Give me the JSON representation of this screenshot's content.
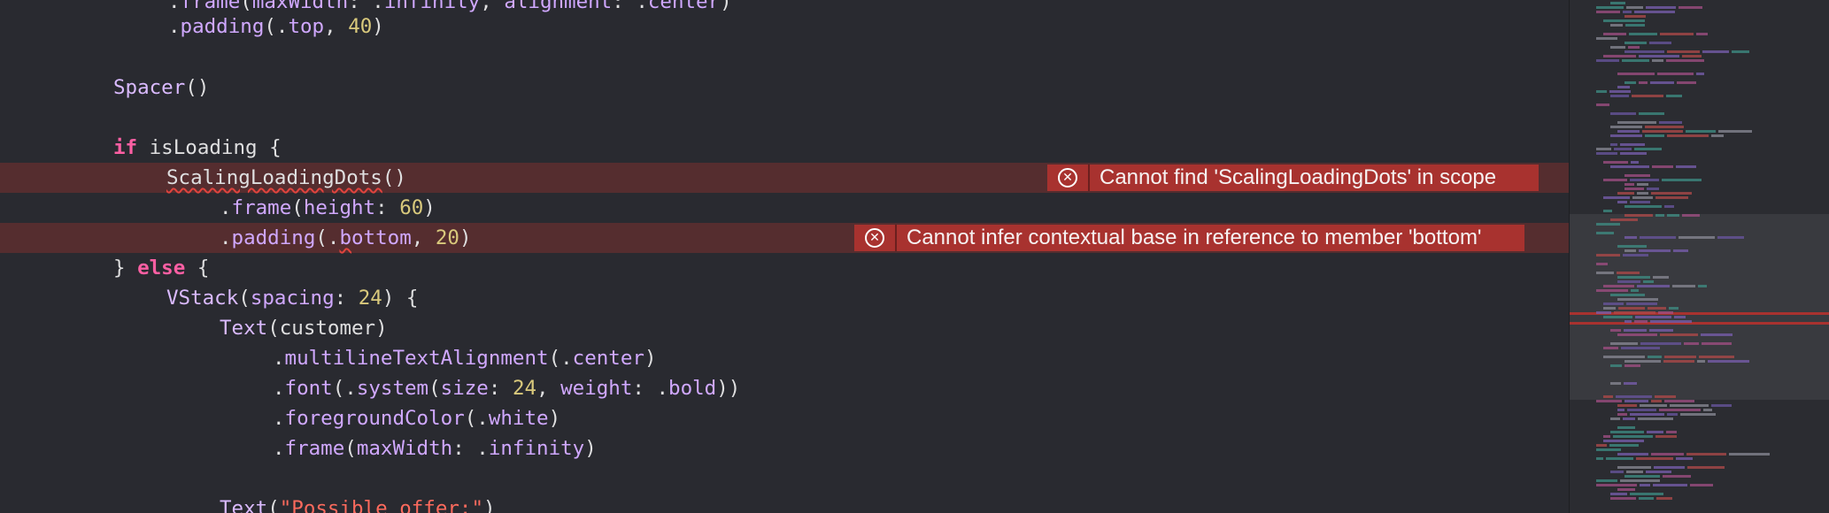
{
  "editor": {
    "tokens": {
      "frame": "frame",
      "max_width": "maxWidth",
      "infinity": "infinity",
      "alignment": "alignment",
      "center": "center",
      "padding": "padding",
      "top": "top",
      "n40": "40",
      "spacer": "Spacer",
      "kw_if": "if",
      "is_loading": "isLoading",
      "scaling_dots": "ScalingLoadingDots",
      "height": "height",
      "n60": "60",
      "bottom_b": "b",
      "bottom_rest": "ottom",
      "n20": "20",
      "kw_else": "else",
      "vstack": "VStack",
      "spacing": "spacing",
      "n24": "24",
      "text": "Text",
      "customer": "customer",
      "multiline": "multilineTextAlignment",
      "font": "font",
      "system": "system",
      "size": "size",
      "weight": "weight",
      "bold": "bold",
      "foreground": "foregroundColor",
      "white": "white",
      "possible_offer": "\"Possible offer:\""
    },
    "errors": [
      {
        "message": "Cannot find 'ScalingLoadingDots' in scope"
      },
      {
        "message": "Cannot infer contextual base in reference to member 'bottom'"
      }
    ]
  },
  "colors": {
    "background": "#292a30",
    "keyword": "#fc5fa3",
    "function": "#d0a8ff",
    "number": "#d9c97c",
    "string": "#fc6a5d",
    "error_badge": "#a8322f"
  },
  "icons": {
    "error": "error-circle-x-icon"
  }
}
